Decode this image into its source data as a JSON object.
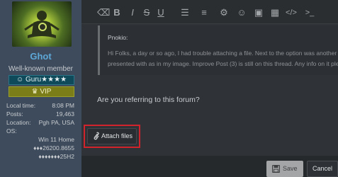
{
  "user": {
    "name": "Ghot",
    "title": "Well-known member",
    "rank": "Guru★★★★",
    "vip": "VIP",
    "stats": [
      {
        "label": "Local time:",
        "value": "8:08 PM"
      },
      {
        "label": "Posts:",
        "value": "19,463"
      },
      {
        "label": "Location:",
        "value": "Pgh PA, USA"
      },
      {
        "label": "OS:",
        "value": ""
      }
    ],
    "os_lines": [
      "Win 11 Home",
      "♦♦♦26200.8655",
      "♦♦♦♦♦♦♦25H2"
    ]
  },
  "toolbar": {
    "buttons": [
      "⌫",
      "B",
      "I",
      "S",
      "U",
      "☰",
      "≡",
      "⚙",
      "☺",
      "▣",
      "▦",
      "</>",
      ">_"
    ]
  },
  "quote": {
    "author": "Pnokio:",
    "line1": "Hi Folks, a day or so ago, I had trouble attaching a file. Next to the option was another b",
    "line2": "presented with as  in my image. Improve Post (3) is still on this thread. Any info on it ple"
  },
  "reply": {
    "text": "Are you referring to this forum?"
  },
  "actions": {
    "attach_label": "Attach files",
    "save_label": "Save",
    "cancel_label": "Cancel"
  },
  "colors": {
    "highlight": "#d0232b",
    "username": "#5ea8d8",
    "rank_bg": "#0f4a5a",
    "vip_bg": "#7a7d18"
  }
}
